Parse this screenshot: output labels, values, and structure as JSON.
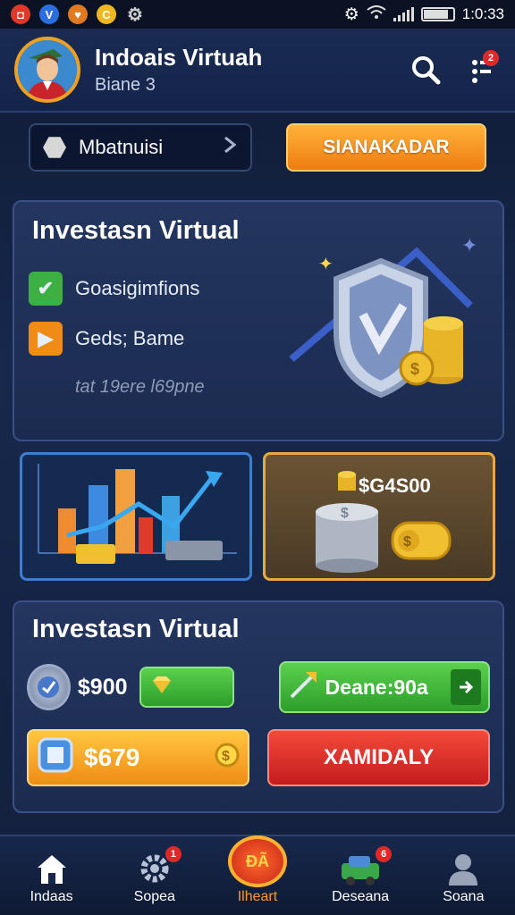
{
  "status_bar": {
    "time": "1:0:33",
    "app_icons": [
      "app-red-icon",
      "app-blue-v-icon",
      "app-orange-shield-icon",
      "app-yellow-c-icon",
      "app-gear-icon"
    ],
    "app_letters": [
      "◘",
      "V",
      "♥",
      "C",
      "⚙"
    ]
  },
  "header": {
    "title": "Indoais Virtuah",
    "subtitle": "Biane 3",
    "notif_badge": "2"
  },
  "controls": {
    "selector_label": "Mbatnuisi",
    "orange_button": "SIANAKADAR"
  },
  "panel1": {
    "title": "Investasn Virtual",
    "items": [
      {
        "label": "Goasigimfions",
        "icon": "check-icon",
        "color": "#3cb043"
      },
      {
        "label": "Geds; Bame",
        "icon": "flag-icon",
        "color": "#f08c14"
      }
    ],
    "faded_text": "tat 19ere l69pne"
  },
  "tiles": {
    "right_amount": "$G4S00"
  },
  "panel2": {
    "title": "Investasn Virtual",
    "amount_left": "$900",
    "green_button_label": "Deane:90a",
    "yellow_button_amount": "$679",
    "red_button_label": "XAMIDALY"
  },
  "bottom_nav": {
    "items": [
      {
        "label": "Indaas",
        "icon": "home-icon",
        "badge": ""
      },
      {
        "label": "Sopea",
        "icon": "gear-icon",
        "badge": "1"
      },
      {
        "label": "Ilheart",
        "icon": "center-badge-icon",
        "badge": "",
        "center_text": "ĐÃ"
      },
      {
        "label": "Deseana",
        "icon": "car-icon",
        "badge": "6"
      },
      {
        "label": "Soana",
        "icon": "user-icon",
        "badge": ""
      }
    ]
  },
  "colors": {
    "accent_orange": "#ee7d10",
    "accent_green": "#2c9e2a",
    "accent_red": "#c41c1c",
    "background": "#17284c"
  }
}
